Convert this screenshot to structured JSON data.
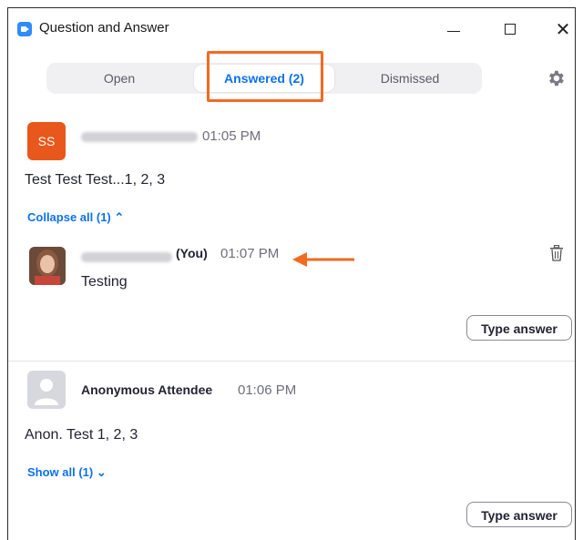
{
  "window": {
    "title": "Question and Answer",
    "controls": {
      "minimize": "minimize",
      "maximize": "maximize",
      "close": "✕"
    }
  },
  "tabs": [
    {
      "label": "Open",
      "selected": false
    },
    {
      "label": "Answered (2)",
      "selected": true
    },
    {
      "label": "Dismissed",
      "selected": false
    }
  ],
  "colors": {
    "accent": "#0e71eb",
    "highlight": "#f26a21",
    "avatar_orange": "#e8571b"
  },
  "questions": [
    {
      "avatar_initials": "SS",
      "time": "01:05 PM",
      "text": "Test Test Test...1, 2, 3",
      "toggle_label": "Collapse all (1) ⌃",
      "answer": {
        "you_label": "(You)",
        "time": "01:07 PM",
        "text": "Testing"
      },
      "type_answer_label": "Type answer"
    },
    {
      "author": "Anonymous Attendee",
      "time": "01:06 PM",
      "text": "Anon. Test 1, 2, 3",
      "toggle_label": "Show all (1) ⌄",
      "type_answer_label": "Type answer"
    }
  ],
  "icons": [
    "app-logo-icon",
    "gear-icon",
    "trash-icon",
    "user-placeholder-icon",
    "arrow-annotation-icon"
  ]
}
